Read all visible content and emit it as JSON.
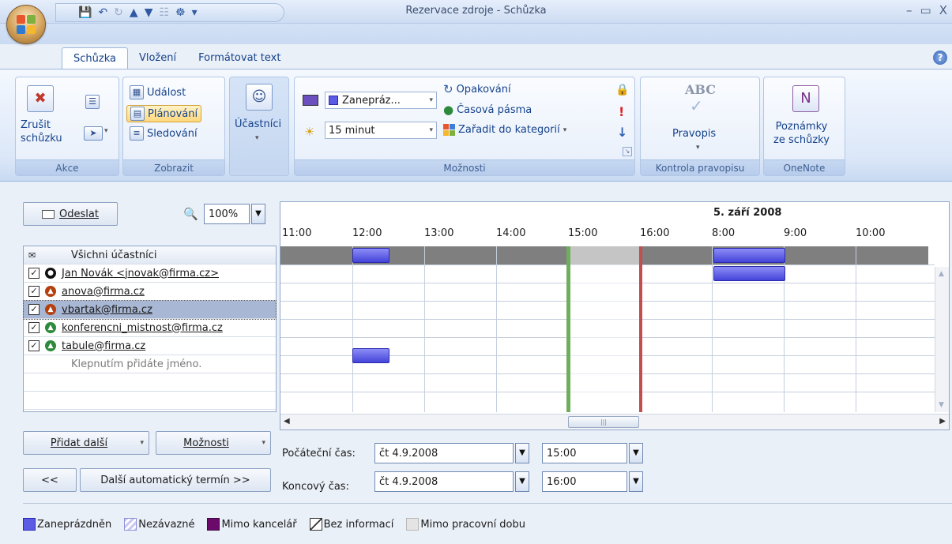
{
  "window": {
    "title": "Rezervace zdroje - Schůzka",
    "controls": [
      "–",
      "▭",
      "X"
    ]
  },
  "tabs": [
    {
      "label": "Schůzka",
      "active": true
    },
    {
      "label": "Vložení",
      "active": false
    },
    {
      "label": "Formátovat text",
      "active": false
    }
  ],
  "ribbon": {
    "akce": {
      "label": "Akce",
      "cancel_line1": "Zrušit",
      "cancel_line2": "schůzku"
    },
    "zobrazit": {
      "label": "Zobrazit",
      "items": [
        "Událost",
        "Plánování",
        "Sledování"
      ]
    },
    "ucastnici": {
      "label": "Účastníci"
    },
    "moznosti": {
      "label": "Možnosti",
      "show_as": "Zanepráz...",
      "reminder": "15 minut",
      "recurrence": "Opakování",
      "timezones": "Časová pásma",
      "categorize": "Zařadit do kategorií"
    },
    "kontrola": {
      "label": "Kontrola pravopisu",
      "spelling": "Pravopis",
      "abc": "ABC"
    },
    "onenote": {
      "label": "OneNote",
      "notes_line1": "Poznámky",
      "notes_line2": "ze schůzky"
    }
  },
  "toolbar": {
    "send": "Odeslat",
    "zoom": "100%"
  },
  "grid": {
    "date": "5. září 2008",
    "hours": [
      "11:00",
      "12:00",
      "13:00",
      "14:00",
      "15:00",
      "16:00",
      "8:00",
      "9:00",
      "10:00"
    ]
  },
  "attendees": {
    "header": "Všichni účastníci",
    "rows": [
      {
        "name": "Jan Novák <jnovak@firma.cz>",
        "checked": true,
        "icon": "organizer-icon"
      },
      {
        "name": "anova@firma.cz",
        "checked": true,
        "icon": "required-attendee-icon"
      },
      {
        "name": "vbartak@firma.cz",
        "checked": true,
        "icon": "required-attendee-icon"
      },
      {
        "name": "konferencni_mistnost@firma.cz",
        "checked": true,
        "icon": "resource-icon"
      },
      {
        "name": "tabule@firma.cz",
        "checked": true,
        "icon": "resource-icon"
      }
    ],
    "add_prompt": "Klepnutím přidáte jméno."
  },
  "bottom": {
    "add_more": "Přidat další",
    "options": "Možnosti",
    "prev": "<<",
    "next_auto": "Další automatický termín >>",
    "start_label": "Počáteční čas:",
    "end_label": "Koncový čas:",
    "start_date": "čt 4.9.2008",
    "start_time": "15:00",
    "end_date": "čt 4.9.2008",
    "end_time": "16:00"
  },
  "legend": [
    {
      "label": "Zaneprázdněn",
      "color": "#5b5be6"
    },
    {
      "label": "Nezávazné",
      "color": "#c8c8f5"
    },
    {
      "label": "Mimo kancelář",
      "color": "#6b0a6b"
    },
    {
      "label": "Bez informací",
      "color": "#ffffff"
    },
    {
      "label": "Mimo pracovní dobu",
      "color": "#e4e4e4"
    }
  ]
}
